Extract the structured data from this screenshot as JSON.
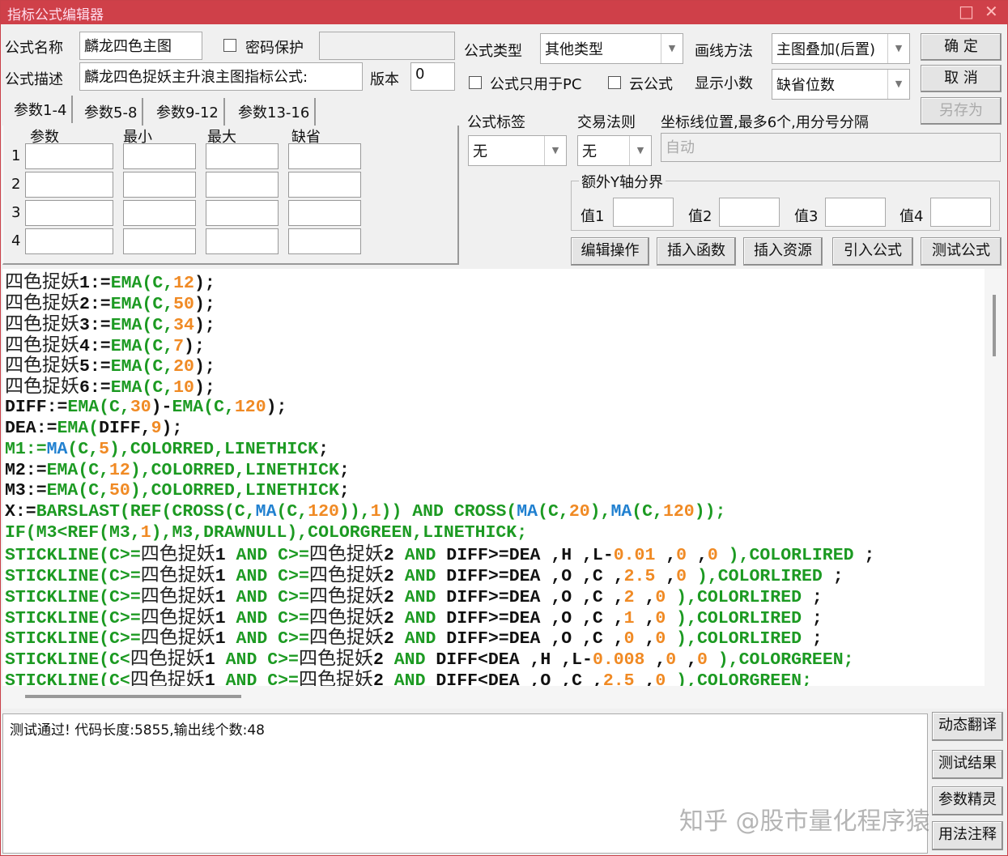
{
  "window": {
    "title": "指标公式编辑器",
    "maximize_icon": "□",
    "close_icon": "✕"
  },
  "form": {
    "name_label": "公式名称",
    "name_value": "麟龙四色主图",
    "password_label": "密码保护",
    "desc_label": "公式描述",
    "desc_value": "麟龙四色捉妖主升浪主图指标公式:",
    "version_label": "版本",
    "version_value": "0",
    "type_label": "公式类型",
    "type_value": "其他类型",
    "draw_label": "画线方法",
    "draw_value": "主图叠加(后置)",
    "pc_only_label": "公式只用于PC",
    "cloud_label": "云公式",
    "decimal_label": "显示小数",
    "decimal_value": "缺省位数",
    "tag_label": "公式标签",
    "tag_value": "无",
    "trade_label": "交易法则",
    "trade_value": "无",
    "axis_label": "坐标线位置,最多6个,用分号分隔",
    "axis_placeholder": "自动",
    "yaxis_group": "额外Y轴分界",
    "y_values": [
      "值1",
      "值2",
      "值3",
      "值4"
    ]
  },
  "buttons": {
    "ok": "确  定",
    "cancel": "取  消",
    "save_as": "另存为",
    "edit_ops": "编辑操作",
    "insert_func": "插入函数",
    "insert_res": "插入资源",
    "import": "引入公式",
    "test": "测试公式",
    "translate": "动态翻译",
    "test_result": "测试结果",
    "param_wizard": "参数精灵",
    "usage": "用法注释"
  },
  "tabs": [
    "参数1-4",
    "参数5-8",
    "参数9-12",
    "参数13-16"
  ],
  "param_headers": [
    "参数",
    "最小",
    "最大",
    "缺省"
  ],
  "param_rows": [
    "1",
    "2",
    "3",
    "4"
  ],
  "code_lines": [
    [
      [
        "四色捉妖",
        "cn"
      ],
      [
        "1:=",
        "k"
      ],
      [
        "EMA(C,",
        "g"
      ],
      [
        "12",
        "o"
      ],
      [
        ");",
        "k"
      ]
    ],
    [
      [
        "四色捉妖",
        "cn"
      ],
      [
        "2:=",
        "k"
      ],
      [
        "EMA(C,",
        "g"
      ],
      [
        "50",
        "o"
      ],
      [
        ");",
        "k"
      ]
    ],
    [
      [
        "四色捉妖",
        "cn"
      ],
      [
        "3:=",
        "k"
      ],
      [
        "EMA(C,",
        "g"
      ],
      [
        "34",
        "o"
      ],
      [
        ");",
        "k"
      ]
    ],
    [
      [
        "四色捉妖",
        "cn"
      ],
      [
        "4:=",
        "k"
      ],
      [
        "EMA(C,",
        "g"
      ],
      [
        "7",
        "o"
      ],
      [
        ");",
        "k"
      ]
    ],
    [
      [
        "四色捉妖",
        "cn"
      ],
      [
        "5:=",
        "k"
      ],
      [
        "EMA(C,",
        "g"
      ],
      [
        "20",
        "o"
      ],
      [
        ");",
        "k"
      ]
    ],
    [
      [
        "四色捉妖",
        "cn"
      ],
      [
        "6:=",
        "k"
      ],
      [
        "EMA(C,",
        "g"
      ],
      [
        "10",
        "o"
      ],
      [
        ");",
        "k"
      ]
    ],
    [
      [
        "DIFF:=",
        "k"
      ],
      [
        "EMA(C,",
        "g"
      ],
      [
        "30",
        "o"
      ],
      [
        ")-",
        "k"
      ],
      [
        "EMA(C,",
        "g"
      ],
      [
        "120",
        "o"
      ],
      [
        ");",
        "k"
      ]
    ],
    [
      [
        "DEA:=",
        "k"
      ],
      [
        "EMA(",
        "g"
      ],
      [
        "DIFF,",
        "k"
      ],
      [
        "9",
        "o"
      ],
      [
        ");",
        "k"
      ]
    ],
    [
      [
        "M1:=",
        "g"
      ],
      [
        "MA",
        "b"
      ],
      [
        "(C,",
        "g"
      ],
      [
        "5",
        "o"
      ],
      [
        "),COLORRED,LINETHICK",
        "g"
      ],
      [
        ";",
        "k"
      ]
    ],
    [
      [
        "M2:=",
        "k"
      ],
      [
        "EMA(C,",
        "g"
      ],
      [
        "12",
        "o"
      ],
      [
        "),COLORRED,LINETHICK",
        "g"
      ],
      [
        ";",
        "k"
      ]
    ],
    [
      [
        "M3:=",
        "k"
      ],
      [
        "EMA(C,",
        "g"
      ],
      [
        "50",
        "o"
      ],
      [
        "),COLORRED,LINETHICK",
        "g"
      ],
      [
        ";",
        "k"
      ]
    ],
    [
      [
        "X:=",
        "k"
      ],
      [
        "BARSLAST(REF(CROSS(C,",
        "g"
      ],
      [
        "MA",
        "b"
      ],
      [
        "(C,",
        "g"
      ],
      [
        "120",
        "o"
      ],
      [
        ")),",
        "g"
      ],
      [
        "1",
        "o"
      ],
      [
        ")) AND CROSS(",
        "g"
      ],
      [
        "MA",
        "b"
      ],
      [
        "(C,",
        "g"
      ],
      [
        "20",
        "o"
      ],
      [
        "),",
        "g"
      ],
      [
        "MA",
        "b"
      ],
      [
        "(C,",
        "g"
      ],
      [
        "120",
        "o"
      ],
      [
        "));",
        "g"
      ]
    ],
    [
      [
        "IF(M3<REF(M3,",
        "g"
      ],
      [
        "1",
        "o"
      ],
      [
        "),M3,DRAWNULL),COLORGREEN,LINETHICK;",
        "g"
      ]
    ],
    [
      [
        "STICKLINE(C>=",
        "g"
      ],
      [
        "四色捉妖",
        "cn"
      ],
      [
        "1 ",
        "k"
      ],
      [
        "AND ",
        "g"
      ],
      [
        "C>=",
        "g"
      ],
      [
        "四色捉妖",
        "cn"
      ],
      [
        "2 ",
        "k"
      ],
      [
        "AND ",
        "g"
      ],
      [
        "DIFF>=DEA ,H ,L-",
        "k"
      ],
      [
        "0.01",
        "o"
      ],
      [
        " ,",
        "k"
      ],
      [
        "0",
        "o"
      ],
      [
        " ,",
        "k"
      ],
      [
        "0",
        "o"
      ],
      [
        " ),COLORLIRED",
        "g"
      ],
      [
        " ;",
        "k"
      ]
    ],
    [
      [
        "STICKLINE(C>=",
        "g"
      ],
      [
        "四色捉妖",
        "cn"
      ],
      [
        "1 ",
        "k"
      ],
      [
        "AND ",
        "g"
      ],
      [
        "C>=",
        "g"
      ],
      [
        "四色捉妖",
        "cn"
      ],
      [
        "2 ",
        "k"
      ],
      [
        "AND ",
        "g"
      ],
      [
        "DIFF>=DEA ,O ,C ,",
        "k"
      ],
      [
        "2.5",
        "o"
      ],
      [
        " ,",
        "k"
      ],
      [
        "0",
        "o"
      ],
      [
        " ),COLORLIRED",
        "g"
      ],
      [
        " ;",
        "k"
      ]
    ],
    [
      [
        "STICKLINE(C>=",
        "g"
      ],
      [
        "四色捉妖",
        "cn"
      ],
      [
        "1 ",
        "k"
      ],
      [
        "AND ",
        "g"
      ],
      [
        "C>=",
        "g"
      ],
      [
        "四色捉妖",
        "cn"
      ],
      [
        "2 ",
        "k"
      ],
      [
        "AND ",
        "g"
      ],
      [
        "DIFF>=DEA ,O ,C ,",
        "k"
      ],
      [
        "2",
        "o"
      ],
      [
        " ,",
        "k"
      ],
      [
        "0",
        "o"
      ],
      [
        " ),COLORLIRED",
        "g"
      ],
      [
        " ;",
        "k"
      ]
    ],
    [
      [
        "STICKLINE(C>=",
        "g"
      ],
      [
        "四色捉妖",
        "cn"
      ],
      [
        "1 ",
        "k"
      ],
      [
        "AND ",
        "g"
      ],
      [
        "C>=",
        "g"
      ],
      [
        "四色捉妖",
        "cn"
      ],
      [
        "2 ",
        "k"
      ],
      [
        "AND ",
        "g"
      ],
      [
        "DIFF>=DEA ,O ,C ,",
        "k"
      ],
      [
        "1",
        "o"
      ],
      [
        " ,",
        "k"
      ],
      [
        "0",
        "o"
      ],
      [
        " ),COLORLIRED",
        "g"
      ],
      [
        " ;",
        "k"
      ]
    ],
    [
      [
        "STICKLINE(C>=",
        "g"
      ],
      [
        "四色捉妖",
        "cn"
      ],
      [
        "1 ",
        "k"
      ],
      [
        "AND ",
        "g"
      ],
      [
        "C>=",
        "g"
      ],
      [
        "四色捉妖",
        "cn"
      ],
      [
        "2 ",
        "k"
      ],
      [
        "AND ",
        "g"
      ],
      [
        "DIFF>=DEA ,O ,C ,",
        "k"
      ],
      [
        "0",
        "o"
      ],
      [
        " ,",
        "k"
      ],
      [
        "0",
        "o"
      ],
      [
        " ),COLORLIRED",
        "g"
      ],
      [
        " ;",
        "k"
      ]
    ],
    [
      [
        "STICKLINE(C<",
        "g"
      ],
      [
        "四色捉妖",
        "cn"
      ],
      [
        "1 ",
        "k"
      ],
      [
        "AND ",
        "g"
      ],
      [
        "C>=",
        "g"
      ],
      [
        "四色捉妖",
        "cn"
      ],
      [
        "2 ",
        "k"
      ],
      [
        "AND ",
        "g"
      ],
      [
        "DIFF<DEA ,H ,L-",
        "k"
      ],
      [
        "0.008",
        "o"
      ],
      [
        " ,",
        "k"
      ],
      [
        "0",
        "o"
      ],
      [
        " ,",
        "k"
      ],
      [
        "0",
        "o"
      ],
      [
        " ),COLORGREEN;",
        "g"
      ]
    ],
    [
      [
        "STICKLINE(C<",
        "g"
      ],
      [
        "四色捉妖",
        "cn"
      ],
      [
        "1 ",
        "k"
      ],
      [
        "AND ",
        "g"
      ],
      [
        "C>=",
        "g"
      ],
      [
        "四色捉妖",
        "cn"
      ],
      [
        "2 ",
        "k"
      ],
      [
        "AND ",
        "g"
      ],
      [
        "DIFF<DEA ,O ,C ,",
        "k"
      ],
      [
        "2.5",
        "o"
      ],
      [
        " ,",
        "k"
      ],
      [
        "0",
        "o"
      ],
      [
        " ),COLORGREEN;",
        "g"
      ]
    ]
  ],
  "output": {
    "text": "测试通过! 代码长度:5855,输出线个数:48"
  },
  "watermark": "知乎 @股市量化程序猿"
}
